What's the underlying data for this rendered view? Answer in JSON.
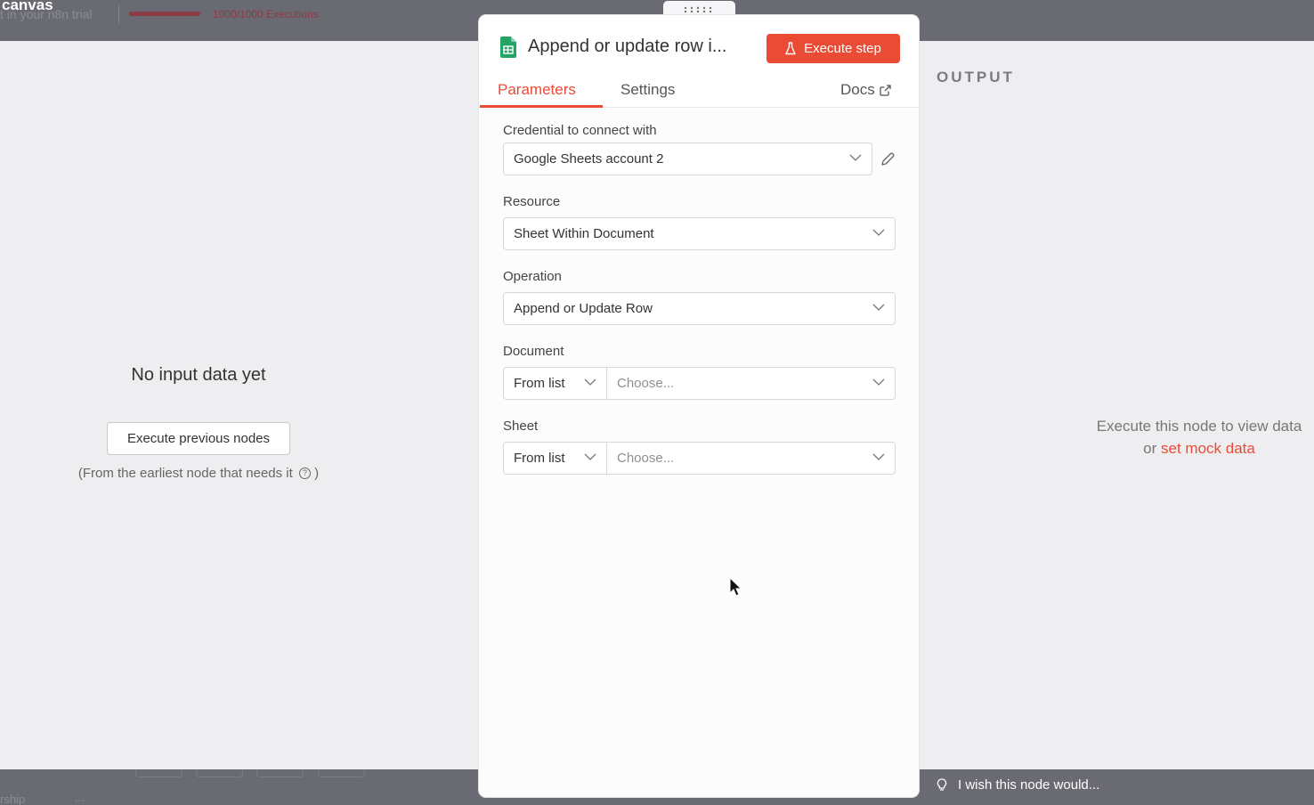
{
  "topbar": {
    "canvas_label": "canvas",
    "trial_text": "t in your n8n trial",
    "executions": "1000/1000 Executions",
    "colors": {
      "bar": "#6a6a72",
      "usage": "#8a3b44"
    }
  },
  "input": {
    "no_data": "No input data yet",
    "execute_previous": "Execute previous nodes",
    "hint": "(From the earliest node that needs it",
    "hint_close": ")",
    "help_icon": "question-circle-icon"
  },
  "node": {
    "icon": "google-sheets-icon",
    "title": "Append or update row i...",
    "execute_label": "Execute step",
    "execute_icon": "flask-icon",
    "accent": "#ea4b35",
    "tabs": [
      {
        "label": "Parameters",
        "active": true
      },
      {
        "label": "Settings",
        "active": false
      }
    ],
    "docs_label": "Docs",
    "docs_icon": "external-link-icon"
  },
  "params": {
    "credential": {
      "label": "Credential to connect with",
      "value": "Google Sheets account 2",
      "edit_icon": "pencil-icon"
    },
    "resource": {
      "label": "Resource",
      "value": "Sheet Within Document"
    },
    "operation": {
      "label": "Operation",
      "value": "Append or Update Row"
    },
    "document": {
      "label": "Document",
      "mode": "From list",
      "placeholder": "Choose..."
    },
    "sheet": {
      "label": "Sheet",
      "mode": "From list",
      "placeholder": "Choose..."
    }
  },
  "output": {
    "title": "OUTPUT",
    "message": "Execute this node to view data",
    "or": "or",
    "mock_link": "set mock data"
  },
  "bottombar": {
    "tab_text": "rship",
    "more": "...",
    "wish": "I wish this node would...",
    "wish_icon": "lightbulb-icon"
  }
}
